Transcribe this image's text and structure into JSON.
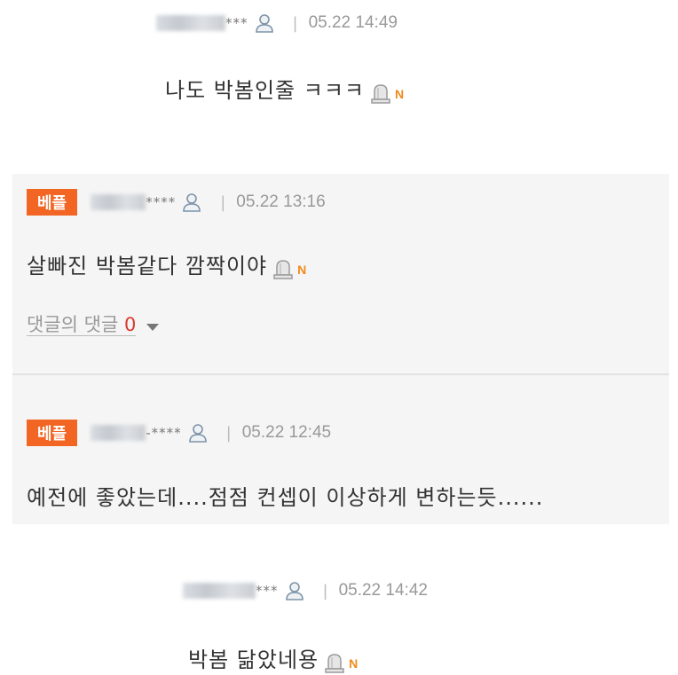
{
  "comments": [
    {
      "masked_suffix": "***",
      "time": "05.22 14:49",
      "text": "나도 박봄인줄 ㅋㅋㅋ",
      "new_label": "N"
    },
    {
      "badge": "베플",
      "masked_suffix": "****",
      "time": "05.22 13:16",
      "text": "살빠진 박봄같다 깜짝이야",
      "new_label": "N",
      "replies_label": "댓글의 댓글",
      "replies_count": "0"
    },
    {
      "badge": "베플",
      "masked_suffix": "-****",
      "time": "05.22 12:45",
      "text": "예전에 좋았는데....점점 컨셉이 이상하게 변하는듯......"
    },
    {
      "masked_suffix": "***",
      "time": "05.22 14:42",
      "text": "박봄 닮았네용",
      "new_label": "N"
    }
  ]
}
